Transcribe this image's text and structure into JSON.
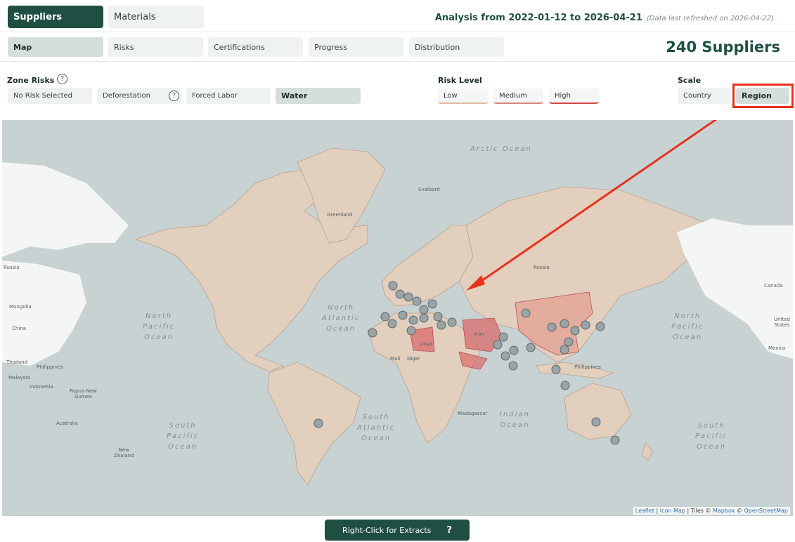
{
  "header": {
    "main_tabs": [
      {
        "label": "Suppliers"
      },
      {
        "label": "Materials"
      }
    ],
    "analysis_title": "Analysis from 2022-01-12 to 2026-04-21",
    "refresh_note": "(Data last refreshed on 2026-04-22)"
  },
  "subnav": {
    "tabs": [
      {
        "label": "Map"
      },
      {
        "label": "Risks"
      },
      {
        "label": "Certifications"
      },
      {
        "label": "Progress"
      },
      {
        "label": "Distribution"
      }
    ],
    "supplier_count": "240 Suppliers"
  },
  "filters": {
    "zone_risks": {
      "title": "Zone Risks",
      "help": "?",
      "options": [
        {
          "label": "No Risk Selected"
        },
        {
          "label": "Deforestation"
        },
        {
          "label": "Forced Labor"
        },
        {
          "label": "Water"
        }
      ],
      "selected": "Water"
    },
    "risk_level": {
      "title": "Risk Level",
      "options": [
        {
          "label": "Low"
        },
        {
          "label": "Medium"
        },
        {
          "label": "High"
        }
      ]
    },
    "scale": {
      "title": "Scale",
      "options": [
        {
          "label": "Country"
        },
        {
          "label": "Region"
        }
      ],
      "selected": "Region"
    }
  },
  "map": {
    "oceans": {
      "arctic": "Arctic Ocean",
      "north_atlantic": "North\nAtlantic\nOcean",
      "north_pacific_left": "North\nPacific\nOcean",
      "north_pacific_right": "North\nPacific\nOcean",
      "south_atlantic": "South\nAtlantic\nOcean",
      "south_pacific_left": "South\nPacific\nOcean",
      "south_pacific_right": "South\nPacific\nOcean",
      "indian": "Indian\nOcean"
    },
    "places": {
      "greenland": "Greenland",
      "svalbard": "Svalbard",
      "russia_left": "Russia",
      "russia": "Russia",
      "canada": "Canada",
      "mongolia": "Mongolia",
      "china": "China",
      "thailand": "Thailand",
      "philippines_left": "Philippines",
      "malaysia": "Malaysia",
      "indonesia": "Indonesia",
      "png": "Papua New\nGuinea",
      "australia": "Australia",
      "nz": "New\nZealand",
      "libya": "Libya",
      "iran": "Iran",
      "united_states": "United\nStates",
      "mexico": "Mexico",
      "mali": "Mali",
      "niger": "Niger",
      "madagascar": "Madagascar",
      "philippines": "Philippines"
    },
    "attribution": {
      "leaflet": "Leaflet",
      "sep1": " | ",
      "iconmap": "Icon Map",
      "tiles": " | Tiles © ",
      "mapbox": "Mapbox",
      "sep2": " © ",
      "osm": "OpenStreetMap"
    }
  },
  "footer": {
    "extract_label": "Right-Click for Extracts",
    "help": "?"
  },
  "colors": {
    "brand": "#1f4f43",
    "highlight_box": "#e8321b",
    "high_risk": "#d96b6b",
    "medium_risk": "#e3a496",
    "land": "#e2cfbd",
    "ocean": "#c9d2d3"
  },
  "icons": {
    "help": "question-circle-icon",
    "marker": "supplier-marker-icon"
  }
}
